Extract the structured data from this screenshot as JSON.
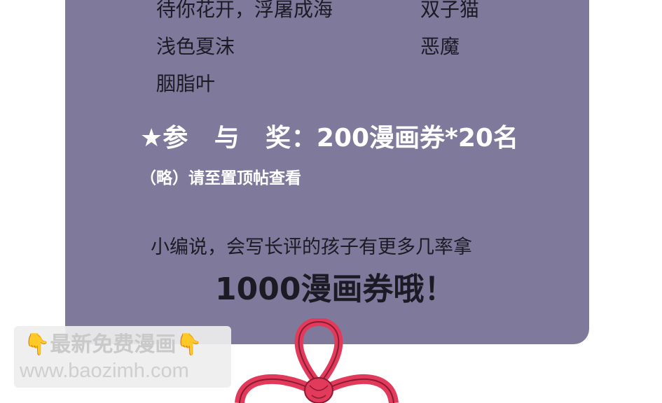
{
  "names": {
    "left": [
      "待你花开，浮屠成海",
      "浅色夏沫",
      "胭脂叶"
    ],
    "right": [
      "双子猫",
      "恶魔"
    ]
  },
  "award": {
    "star": "★",
    "label": "参　与　奖",
    "colon": "：",
    "prize": "200漫画券*20名"
  },
  "note": "（略）请至置顶帖查看",
  "editor_line": "小编说，会写长评的孩子有更多几率拿",
  "big_line": "1000漫画券哦！",
  "watermark": {
    "title": "最新免费漫画",
    "url": "www.baozimh.com",
    "hand_icon": "pointing-down-hand"
  },
  "colors": {
    "panel": "#7f7a9c",
    "bow": "#e23a5b",
    "text_dark": "#1c1a24",
    "text_light": "#ffffff"
  }
}
